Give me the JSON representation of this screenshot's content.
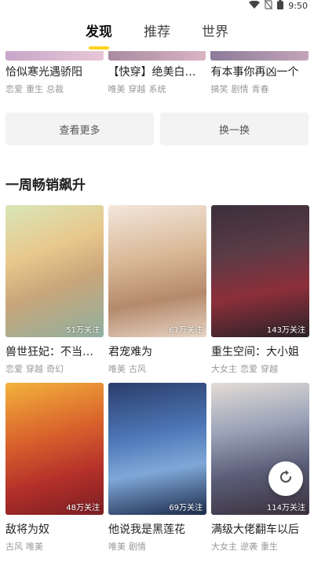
{
  "status_bar": {
    "time": "9:50",
    "icons": [
      "wifi-icon",
      "no-sim-icon",
      "battery-icon"
    ]
  },
  "tabs": [
    {
      "label": "发现",
      "active": true
    },
    {
      "label": "推荐",
      "active": false
    },
    {
      "label": "世界",
      "active": false
    }
  ],
  "top_row": [
    {
      "title": "恰似寒光遇骄阳",
      "tags": [
        "恋爱",
        "重生",
        "总裁"
      ]
    },
    {
      "title": "【快穿】绝美白莲在线教学",
      "tags": [
        "唯美",
        "穿越",
        "系统"
      ]
    },
    {
      "title": "有本事你再凶一个",
      "tags": [
        "搞笑",
        "剧情",
        "青春"
      ]
    }
  ],
  "buttons": {
    "more": "查看更多",
    "swap": "换一换"
  },
  "section": {
    "title": "一周畅销飙升"
  },
  "weekly_rows": [
    [
      {
        "title": "兽世狂妃：不当宠妃",
        "followers": "51万关注",
        "tags": [
          "恋爱",
          "穿越",
          "奇幻"
        ]
      },
      {
        "title": "君宠难为",
        "followers": "61万关注",
        "tags": [
          "唯美",
          "古风"
        ]
      },
      {
        "title": "重生空间：大小姐",
        "followers": "143万关注",
        "tags": [
          "大女主",
          "恋爱",
          "穿越"
        ]
      }
    ],
    [
      {
        "title": "敌将为奴",
        "followers": "48万关注",
        "tags": [
          "古风",
          "唯美"
        ]
      },
      {
        "title": "他说我是黑莲花",
        "followers": "69万关注",
        "tags": [
          "唯美",
          "剧情"
        ]
      },
      {
        "title": "满级大佬翻车以后",
        "followers": "114万关注",
        "tags": [
          "大女主",
          "逆袭",
          "重生"
        ]
      }
    ]
  ],
  "colors": {
    "accent": "#ffd21e",
    "tag": "#999999",
    "button_bg": "#f3f3f3"
  }
}
